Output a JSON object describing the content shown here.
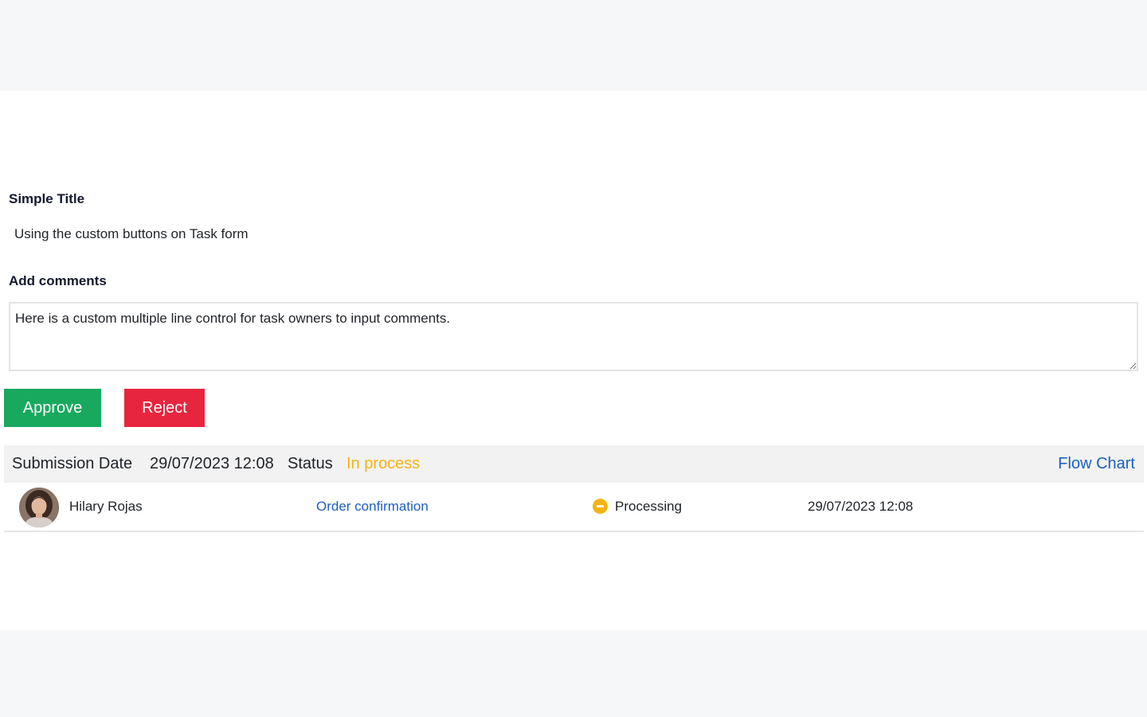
{
  "form": {
    "title_label": "Simple Title",
    "title_value": "Using the custom buttons on Task form",
    "comments_label": "Add comments",
    "comments_value": "Here is a custom multiple line control for task owners to input comments."
  },
  "actions": {
    "approve_label": "Approve",
    "reject_label": "Reject"
  },
  "status_bar": {
    "submission_date_label": "Submission Date",
    "submission_date_value": "29/07/2023 12:08",
    "status_label": "Status",
    "status_value": "In process",
    "flow_chart_link": "Flow Chart"
  },
  "task_rows": [
    {
      "user": "Hilary Rojas",
      "step": "Order confirmation",
      "status_icon": "minus-circle-icon",
      "status": "Processing",
      "date": "29/07/2023 12:08"
    }
  ],
  "colors": {
    "approve": "#18a95f",
    "reject": "#e8253f",
    "status_in_process": "#f2b412",
    "link": "#1c5fc2",
    "processing_icon": "#f4b40e"
  }
}
